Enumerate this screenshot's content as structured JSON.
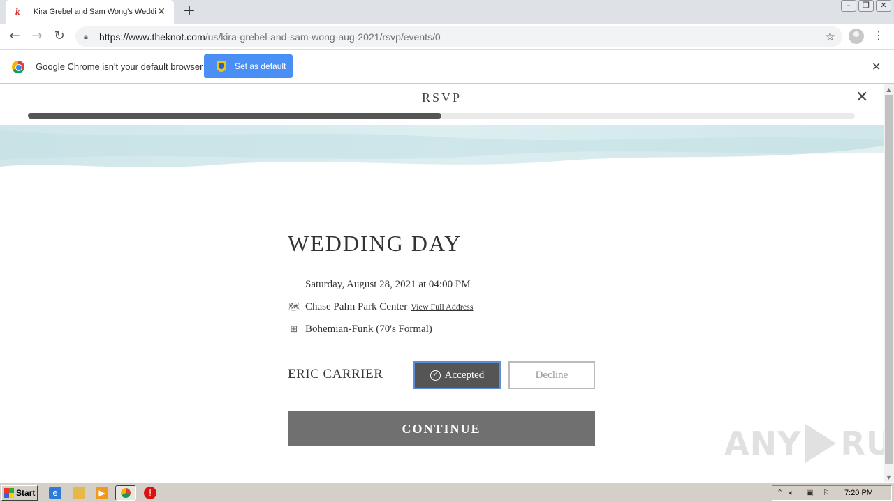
{
  "browser": {
    "tab_title": "Kira Grebel and Sam Wong's Wedding",
    "tab_favicon": "knot-logo-icon",
    "url_host": "https://www.theknot.com",
    "url_path": "/us/kira-grebel-and-sam-wong-aug-2021/rsvp/events/0"
  },
  "infobar": {
    "message": "Google Chrome isn't your default browser",
    "button_label": "Set as default"
  },
  "rsvp": {
    "title": "RSVP",
    "progress": 0.5,
    "event_title": "WEDDING DAY",
    "date": "Saturday, August 28, 2021 at 04:00 PM",
    "venue": "Chase Palm Park Center",
    "view_address_label": "View Full Address",
    "attire": "Bohemian-Funk (70's Formal)",
    "guest_name": "ERIC CARRIER",
    "accept_label": "Accepted",
    "decline_label": "Decline",
    "continue_label": "CONTINUE"
  },
  "watermark": {
    "left": "ANY",
    "right": "RUN"
  },
  "taskbar": {
    "start_label": "Start",
    "clock": "7:20 PM"
  },
  "colors": {
    "accent_blue": "#4a8ff5",
    "progress_fill": "#555555",
    "continue_bg": "#707070",
    "accept_bg": "#555555"
  }
}
